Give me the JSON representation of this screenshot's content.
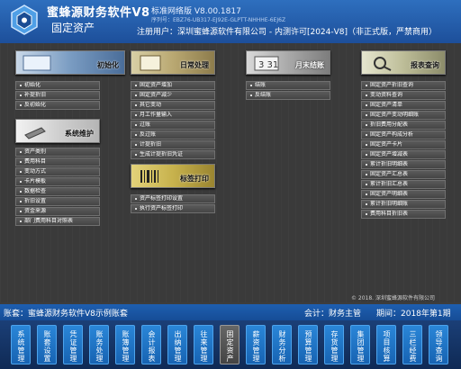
{
  "header": {
    "brand": "蜜蜂源财务软件V8",
    "version": "标准网络版 V8.00.1817",
    "serial": "序列号：EBZ76-UB317-EJ92E-GLPTT-NHHHE-6EJ6Z",
    "module": "固定资产",
    "registration": "注册用户：深圳蜜蜂源软件有限公司 - 内测许可[2024-V8]（非正式版，严禁商用）"
  },
  "groups": {
    "init": {
      "banner": "初始化",
      "items": [
        "初始化",
        "补提折旧",
        "反初始化"
      ]
    },
    "daily": {
      "banner": "日常处理",
      "items": [
        "固定资产增加",
        "固定资产减少",
        "其它变动",
        "月工作量输入",
        "过账",
        "反过账",
        "计提折旧",
        "生成计提折旧凭证"
      ]
    },
    "month_end": {
      "banner": "月末结账",
      "items": [
        "结账",
        "反结账"
      ]
    },
    "report": {
      "banner": "报表查询",
      "items": [
        "固定资产折旧查询",
        "变动资料查询",
        "固定资产清单",
        "固定资产变动明细账",
        "折旧费用分配表",
        "固定资产构成分析",
        "固定资产卡片",
        "固定资产增减表",
        "累计折旧明细表",
        "固定资产汇总表",
        "累计折旧汇总表",
        "固定资产明细表",
        "累计折旧明细账",
        "费用科目折旧表"
      ]
    },
    "system": {
      "banner": "系统维护",
      "items": [
        "资产类别",
        "费用科目",
        "变动方式",
        "卡片模板",
        "数据检查",
        "折旧设置",
        "资金来源",
        "部门费用科目对照表"
      ]
    },
    "label": {
      "banner": "标签打印",
      "items": [
        "资产标签打印设置",
        "执行资产标签打印"
      ]
    }
  },
  "copyright": "© 2018. 深圳蜜蜂源软件有限公司",
  "status": {
    "account_set": "账套：蜜蜂源财务软件V8示例账套",
    "accountant": "会计：财务主管",
    "period": "期间：2018年第1期"
  },
  "toolbar": [
    "系统管理",
    "账套设置",
    "凭证管理",
    "账务处理",
    "账簿管理",
    "会计报表",
    "出纳管理",
    "往来管理",
    "固定资产",
    "薪资管理",
    "财务分析",
    "预算管理",
    "存货管理",
    "集团管理",
    "项目核算",
    "三栏经费",
    "领导查询"
  ],
  "active_module": "固定资产",
  "colors": {
    "header": "#2e6fbe",
    "panel": "#3a3a3a",
    "toolbar_button": "#2a86d8"
  }
}
